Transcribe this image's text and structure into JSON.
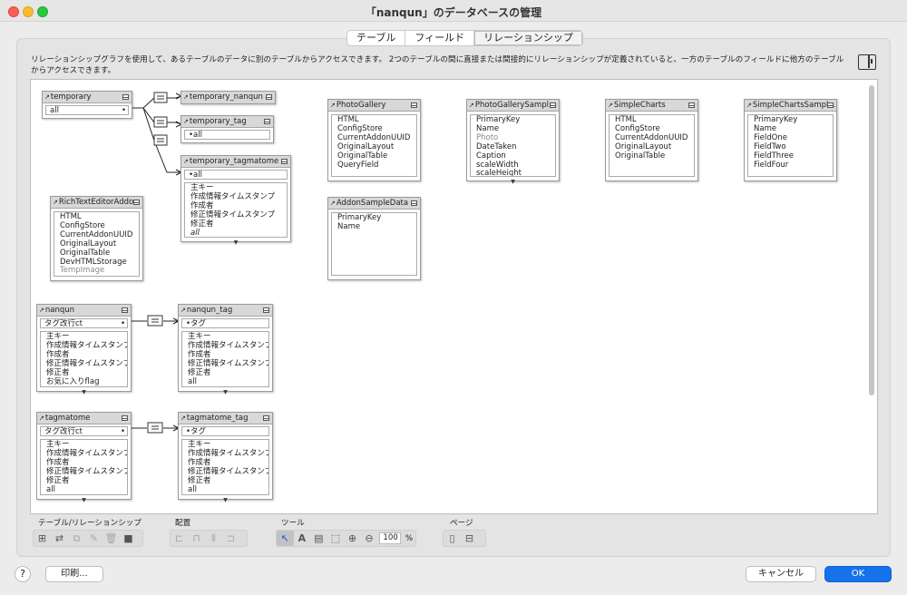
{
  "window": {
    "title": "「nanqun」のデータベースの管理"
  },
  "tabs": [
    {
      "label": "テーブル",
      "active": false
    },
    {
      "label": "フィールド",
      "active": false
    },
    {
      "label": "リレーションシップ",
      "active": true
    }
  ],
  "description": "リレーションシップグラフを使用して、あるテーブルのデータに別のテーブルからアクセスできます。 2つのテーブルの間に直接または間接的にリレーションシップが定義されていると、一方のテーブルのフィールドに他方のテーブルからアクセスできます。",
  "relationship_tables": [
    {
      "name": "temporary",
      "key": "all"
    },
    {
      "name": "temporary_nanqun"
    },
    {
      "name": "temporary_tag",
      "key": "all"
    },
    {
      "name": "temporary_tagmatome",
      "key": "all",
      "fields": [
        "主キー",
        "作成情報タイムスタンプ",
        "作成者",
        "修正情報タイムスタンプ",
        "修正者",
        "all"
      ]
    },
    {
      "name": "RichTextEditorAddon",
      "fields": [
        "HTML",
        "ConfigStore",
        "CurrentAddonUUID",
        "OriginalLayout",
        "OriginalTable",
        "DevHTMLStorage",
        "TempImage"
      ]
    },
    {
      "name": "PhotoGallery",
      "fields": [
        "HTML",
        "ConfigStore",
        "CurrentAddonUUID",
        "OriginalLayout",
        "OriginalTable",
        "QueryField"
      ]
    },
    {
      "name": "PhotoGallerySampl...",
      "fields": [
        "PrimaryKey",
        "Name",
        "Photo",
        "DateTaken",
        "Caption",
        "scaleWidth",
        "scaleHeight"
      ]
    },
    {
      "name": "SimpleCharts",
      "fields": [
        "HTML",
        "ConfigStore",
        "CurrentAddonUUID",
        "OriginalLayout",
        "OriginalTable"
      ]
    },
    {
      "name": "SimpleChartsSampl...",
      "fields": [
        "PrimaryKey",
        "Name",
        "FieldOne",
        "FieldTwo",
        "FieldThree",
        "FieldFour"
      ]
    },
    {
      "name": "AddonSampleData",
      "fields": [
        "PrimaryKey",
        "Name"
      ]
    },
    {
      "name": "nanqun",
      "key": "タグ改行ct",
      "fields": [
        "主キー",
        "作成情報タイムスタンプ",
        "作成者",
        "修正情報タイムスタンプ",
        "修正者",
        "お気に入りflag"
      ]
    },
    {
      "name": "nanqun_tag",
      "key": "タグ",
      "fields": [
        "主キー",
        "作成情報タイムスタンプ",
        "作成者",
        "修正情報タイムスタンプ",
        "修正者",
        "all"
      ]
    },
    {
      "name": "tagmatome",
      "key": "タグ改行ct",
      "fields": [
        "主キー",
        "作成情報タイムスタンプ",
        "作成者",
        "修正情報タイムスタンプ",
        "修正者",
        "all"
      ]
    },
    {
      "name": "tagmatome_tag",
      "key": "タグ",
      "fields": [
        "主キー",
        "作成情報タイムスタンプ",
        "作成者",
        "修正情報タイムスタンプ",
        "修正者",
        "all"
      ]
    }
  ],
  "toolbar": {
    "group_table_relationship": "テーブル/リレーションシップ",
    "group_arrange": "配置",
    "group_tools": "ツール",
    "group_page": "ページ",
    "zoom": "100",
    "zoom_unit": "%"
  },
  "buttons": {
    "help": "?",
    "print": "印刷...",
    "cancel": "キャンセル",
    "ok": "OK"
  },
  "colors": {
    "accent": "#1572ea",
    "header": "#d8d8d8"
  }
}
